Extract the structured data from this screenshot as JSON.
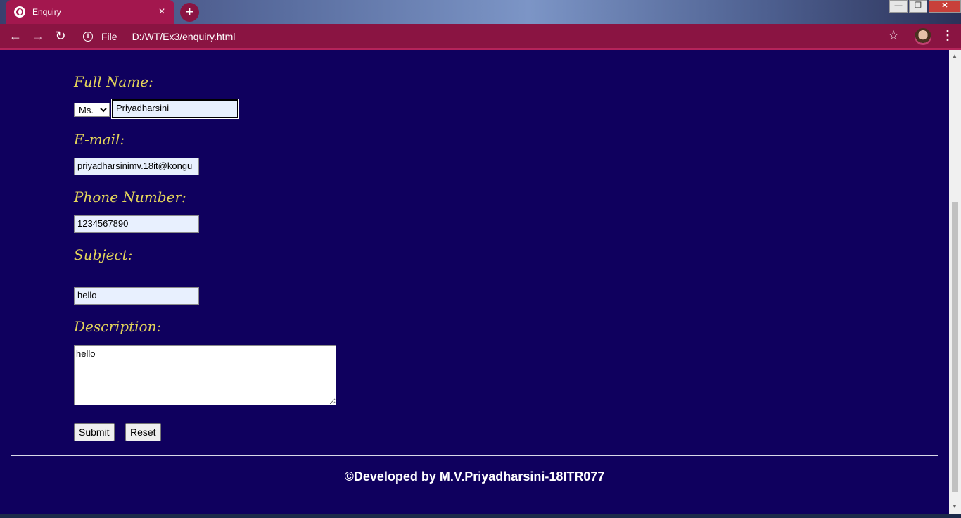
{
  "browser": {
    "tab_title": "Enquiry",
    "tab_close": "×",
    "new_tab": "+",
    "scheme": "File",
    "url": "D:/WT/Ex3/enquiry.html",
    "win_min": "—",
    "win_restore": "❐",
    "win_close": "✕"
  },
  "form": {
    "full_name_label": "Full Name:",
    "title_options": [
      "Ms."
    ],
    "title_selected": "Ms.",
    "full_name_value": "Priyadharsini",
    "email_label": "E-mail:",
    "email_value": "priyadharsinimv.18it@kongu",
    "phone_label": "Phone Number:",
    "phone_value": "1234567890",
    "subject_label": "Subject:",
    "subject_value": "hello",
    "description_label": "Description:",
    "description_value": "hello",
    "submit_label": "Submit",
    "reset_label": "Reset"
  },
  "footer": {
    "text": "©Developed by M.V.Priyadharsini-18ITR077"
  },
  "colors": {
    "page_bg": "#0f005e",
    "label": "#e3d45a",
    "toolbar": "#8a1442",
    "tab": "#a3174e"
  }
}
